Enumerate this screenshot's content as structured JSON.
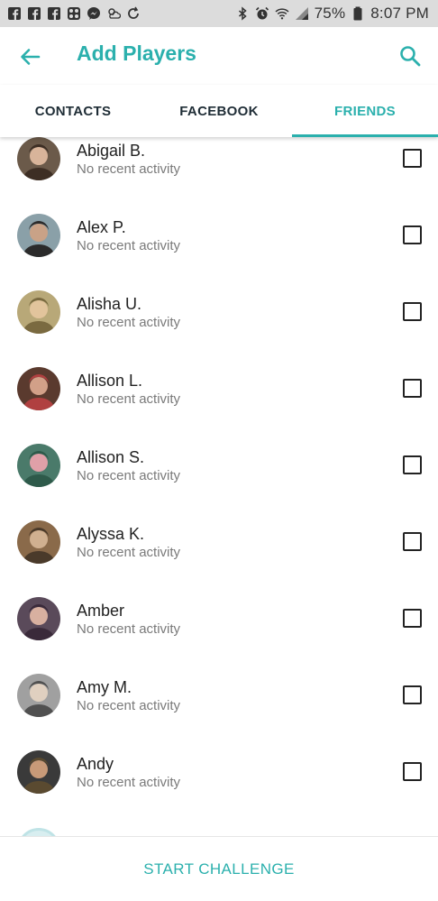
{
  "status_bar": {
    "battery_text": "75%",
    "time": "8:07 PM",
    "left_icons": [
      "facebook-icon",
      "facebook-icon",
      "facebook-icon",
      "app-icon",
      "messenger-icon",
      "weather-icon",
      "sync-icon"
    ],
    "right_icons": [
      "bluetooth-icon",
      "alarm-icon",
      "wifi-icon",
      "signal-icon",
      "battery-icon"
    ]
  },
  "app_bar": {
    "title": "Add Players",
    "accent_color": "#2bb0ad"
  },
  "tabs": [
    {
      "label": "CONTACTS",
      "active": false
    },
    {
      "label": "FACEBOOK",
      "active": false
    },
    {
      "label": "FRIENDS",
      "active": true
    }
  ],
  "friends": [
    {
      "name": "Abigail B.",
      "activity": "No recent activity",
      "checked": false
    },
    {
      "name": "Alex P.",
      "activity": "No recent activity",
      "checked": false
    },
    {
      "name": "Alisha U.",
      "activity": "No recent activity",
      "checked": false
    },
    {
      "name": "Allison L.",
      "activity": "No recent activity",
      "checked": false
    },
    {
      "name": "Allison S.",
      "activity": "No recent activity",
      "checked": false
    },
    {
      "name": "Alyssa K.",
      "activity": "No recent activity",
      "checked": false
    },
    {
      "name": "Amber",
      "activity": "No recent activity",
      "checked": false
    },
    {
      "name": "Amy M.",
      "activity": "No recent activity",
      "checked": false
    },
    {
      "name": "Andy",
      "activity": "No recent activity",
      "checked": false
    }
  ],
  "bottom": {
    "start_label": "START CHALLENGE"
  }
}
